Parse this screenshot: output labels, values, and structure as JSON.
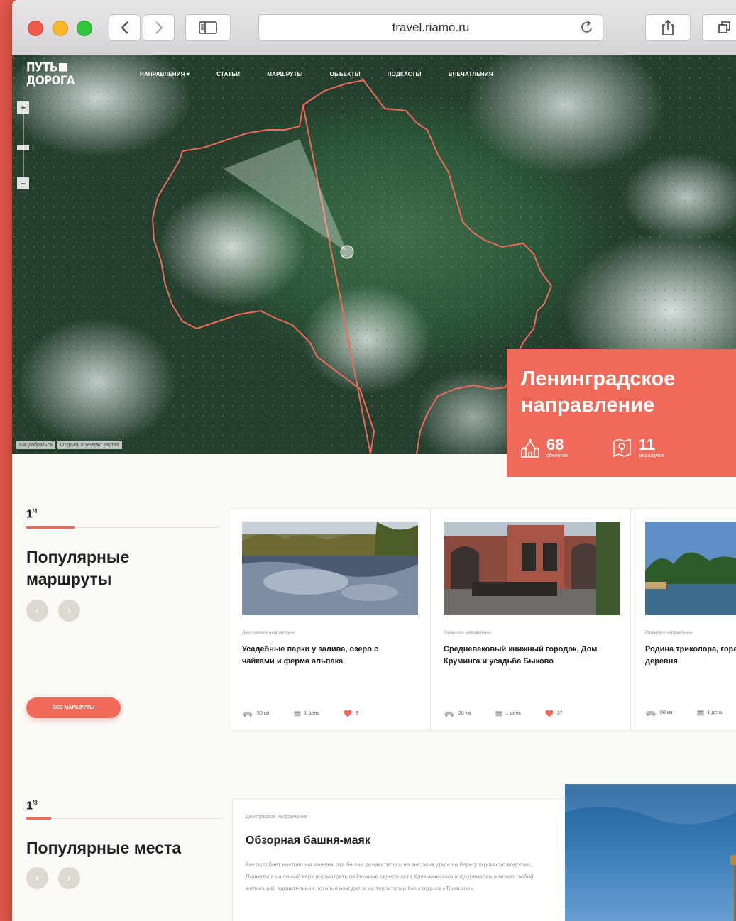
{
  "browser": {
    "url": "travel.riamo.ru",
    "back_icon": "chevron-left-icon",
    "forward_icon": "chevron-right-icon",
    "sidebar_icon": "sidebar-icon",
    "reload_icon": "reload-icon",
    "share_icon": "share-icon",
    "tabs_icon": "tabs-icon"
  },
  "site": {
    "logo_line1": "ПУТЬ",
    "logo_line2": "ДОРОГА"
  },
  "nav": {
    "items": [
      "Направления",
      "Статьи",
      "Маршруты",
      "Объекты",
      "Подкасты",
      "Впечатления"
    ],
    "dropdown_marker": "▾"
  },
  "map": {
    "zoom_in": "+",
    "zoom_out": "−",
    "credit_1": "Как добраться",
    "credit_2": "Открыть в Яндекс.Картах"
  },
  "direction": {
    "title_line1": "Ленинградское",
    "title_line2": "направление",
    "objects_count": "68",
    "objects_label": "объектов",
    "routes_count": "11",
    "routes_label": "маршрутов"
  },
  "popular_routes": {
    "counter": "1",
    "counter_total": "/4",
    "title_line1": "Популярные",
    "title_line2": "маршруты",
    "prev": "‹",
    "next": "›",
    "all_button": "Все маршруты",
    "cards": [
      {
        "direction": "Дмитровское направление",
        "title": "Усадебные парки у залива, озеро с чайками и ферма альпака",
        "distance": "50 км",
        "duration": "1 день",
        "likes": "9"
      },
      {
        "direction": "Рязанское направление",
        "title": "Средневековый книжный городок, Дом Круминга и усадьба Быково",
        "distance": "20 км",
        "duration": "1 день",
        "likes": "37"
      },
      {
        "direction": "Рязанское направление",
        "title": "Родина триколора, гора, заброшенная деревня",
        "distance": "60 км",
        "duration": "1 день",
        "likes": ""
      }
    ]
  },
  "popular_places": {
    "counter": "1",
    "counter_total": "/8",
    "title": "Популярные места",
    "prev": "‹",
    "next": "›",
    "card": {
      "direction": "Дмитровское направление",
      "title": "Обзорная башня-маяк",
      "text": "Как подобает настоящим маякам, эта башня разместилась на высоком утесе на берегу огромного водоема. Подняться на самый верх и осмотреть пейзажные окрестности Клязьминского водохранилища может любой желающий. Удивительная локация находится на территории базы отдыха «Троицкое»."
    }
  },
  "colors": {
    "accent": "#f06a5b",
    "background": "#fbfaf7",
    "page_border": "#e9594d"
  }
}
